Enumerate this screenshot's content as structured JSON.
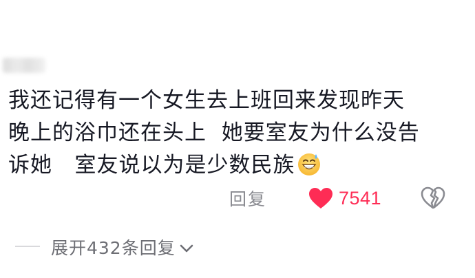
{
  "comment": {
    "lines": [
      "我还记得有一个女生去上班回来发现昨天",
      "晚上的浴巾还在头上  她要室友为什么没告",
      "诉她   室友说以为是少数民族"
    ],
    "emoji": "sweat-smile-emoji"
  },
  "actions": {
    "reply_label": "回复",
    "like_count": "7541",
    "like_icon": "heart-icon",
    "dislike_icon": "broken-heart-icon"
  },
  "expand": {
    "label": "展开432条回复",
    "icon": "chevron-down-icon"
  },
  "colors": {
    "like": "#fe2c55",
    "text": "#161823",
    "muted": "#8a8b91"
  }
}
